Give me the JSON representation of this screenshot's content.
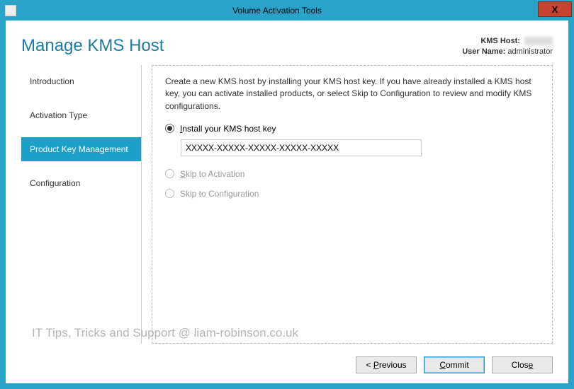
{
  "window": {
    "title": "Volume Activation Tools",
    "close_glyph": "X"
  },
  "header": {
    "page_title": "Manage KMS Host",
    "kms_host_label": "KMS Host:",
    "kms_host_value": "",
    "user_label": "User Name:",
    "user_value": "administrator"
  },
  "nav": {
    "items": [
      {
        "label": "Introduction",
        "active": false
      },
      {
        "label": "Activation Type",
        "active": false
      },
      {
        "label": "Product Key Management",
        "active": true
      },
      {
        "label": "Configuration",
        "active": false
      }
    ]
  },
  "content": {
    "description": "Create a new KMS host by installing your KMS host key. If you have already installed a KMS host key, you can activate installed products, or select Skip to Configuration to review and modify KMS configurations.",
    "options": {
      "install": {
        "prefix": "I",
        "rest": "nstall your KMS host key",
        "enabled": true,
        "selected": true
      },
      "skip_activation": {
        "prefix": "S",
        "rest": "kip to Activation",
        "enabled": false,
        "selected": false
      },
      "skip_config": {
        "label": "Skip to Configuration",
        "enabled": false,
        "selected": false
      }
    },
    "key_input_value": "XXXXX-XXXXX-XXXXX-XXXXX-XXXXX"
  },
  "footer": {
    "previous_prefix": "< ",
    "previous_access": "P",
    "previous_rest": "revious",
    "commit_access": "C",
    "commit_rest": "ommit",
    "close_prefix": "Clos",
    "close_access": "e"
  },
  "watermark": "IT Tips, Tricks and Support @ liam-robinson.co.uk"
}
